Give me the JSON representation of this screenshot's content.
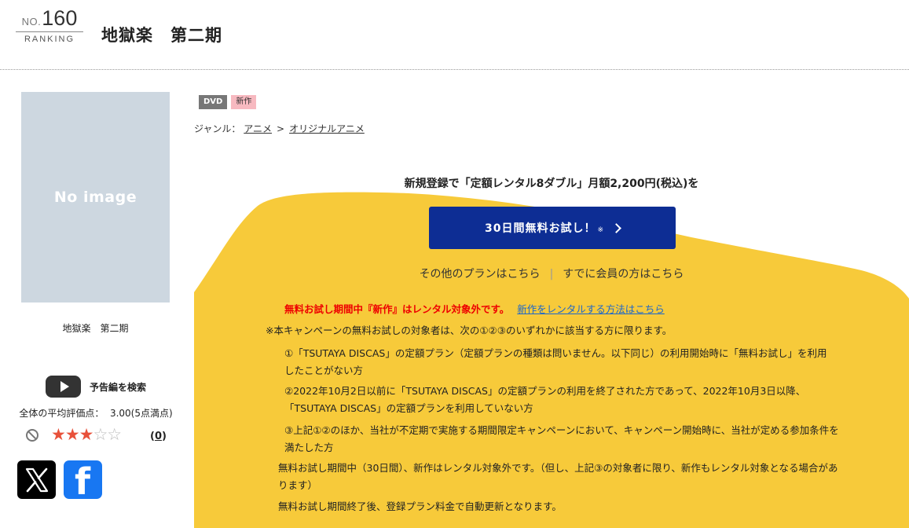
{
  "header": {
    "rank_prefix": "NO.",
    "rank_number": "160",
    "rank_label": "RANKING",
    "title": "地獄楽　第二期"
  },
  "poster": {
    "placeholder": "No image"
  },
  "sidebar": {
    "under_title": "地獄楽　第二期",
    "trailer_label": "予告編を検索",
    "avg_rating": "全体の平均評価点：  3.00(5点満点)",
    "stars_filled": 3,
    "stars_total": 5,
    "review_count_open": "(",
    "review_count": "0",
    "review_count_close": ")"
  },
  "tags": {
    "format": "DVD",
    "badge": "新作"
  },
  "genre": {
    "label": "ジャンル：",
    "items": [
      "アニメ",
      "オリジナルアニメ"
    ],
    "separator": ">"
  },
  "promo": {
    "headline": "新規登録で「定額レンタル8ダブル」月額2,200円(税込)を",
    "cta_label": "30日間無料お試し！",
    "cta_mark": "※",
    "link_other_plans": "その他のプランはこちら",
    "link_separator": "|",
    "link_members": "すでに会員の方はこちら",
    "warning_red": "無料お試し期間中『新作』はレンタル対象外です。",
    "warning_link": "新作をレンタルする方法はこちら",
    "note_intro": "※本キャンペーンの無料お試しの対象者は、次の①②③のいずれかに該当する方に限ります。",
    "condition_1": "①「TSUTAYA DISCAS」の定額プラン（定額プランの種類は問いません。以下同じ）の利用開始時に「無料お試し」を利用したことがない方",
    "condition_2": "②2022年10月2日以前に「TSUTAYA DISCAS」の定額プランの利用を終了された方であって、2022年10月3日以降、「TSUTAYA DISCAS」の定額プランを利用していない方",
    "condition_3": "③上記①②のほか、当社が不定期で実施する期間限定キャンペーンにおいて、キャンペーン開始時に、当社が定める参加条件を満たした方",
    "note_new": "無料お試し期間中（30日間）、新作はレンタル対象外です。（但し、上記③の対象者に限り、新作もレンタル対象となる場合があります）",
    "note_renew": "無料お試し期間終了後、登録プラン料金で自動更新となります。"
  },
  "colors": {
    "promo_yellow": "#f7ca3a",
    "cta_blue": "#0d2d94",
    "warning_red": "#e00000",
    "link_blue": "#1a66cc",
    "star_on": "#e8513a",
    "facebook": "#1877f2"
  }
}
